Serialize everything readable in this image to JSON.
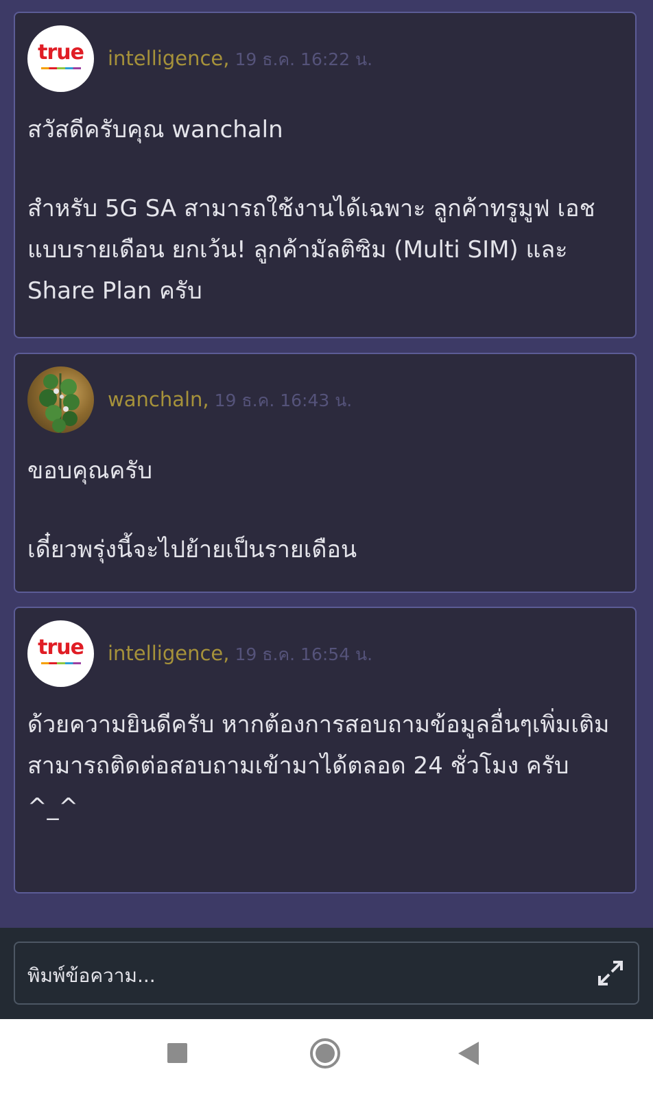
{
  "messages": [
    {
      "author": "intelligence,",
      "timestamp": "19 ธ.ค. 16:22 น.",
      "avatar": "true-logo",
      "avatar_text": "true",
      "paragraphs": [
        "สวัสดีครับคุณ wanchaln",
        "สำหรับ 5G SA สามารถใช้งานได้เฉพาะ ลูกค้าทรูมูฟ เอช แบบรายเดือน ยกเว้น! ลูกค้ามัลติซิม (Multi SIM) และ Share Plan ครับ"
      ]
    },
    {
      "author": "wanchaln,",
      "timestamp": "19 ธ.ค. 16:43 น.",
      "avatar": "plant-photo",
      "paragraphs": [
        "ขอบคุณครับ",
        "เดี๋ยวพรุ่งนี้จะไปย้ายเป็นรายเดือน"
      ]
    },
    {
      "author": "intelligence,",
      "timestamp": "19 ธ.ค. 16:54 น.",
      "avatar": "true-logo",
      "avatar_text": "true",
      "paragraphs": [
        "ด้วยความยินดีครับ หากต้องการสอบถามข้อมูลอื่นๆเพิ่มเติมสามารถติดต่อสอบถามเข้ามาได้ตลอด 24 ชั่วโมง ครับ ^_^"
      ]
    }
  ],
  "composer": {
    "placeholder": "พิมพ์ข้อความ...",
    "expand_icon": "expand-icon"
  },
  "nav": {
    "recents_icon": "square-icon",
    "home_icon": "circle-icon",
    "back_icon": "triangle-back-icon"
  },
  "colors": {
    "page_bg": "#3d3a66",
    "card_bg": "#2c2a3d",
    "card_border": "#5c5c96",
    "author": "#a6923a",
    "timestamp": "#55537a",
    "text": "#e4e4ea",
    "composer_bg": "#232a33",
    "brand_red": "#e01d25"
  }
}
